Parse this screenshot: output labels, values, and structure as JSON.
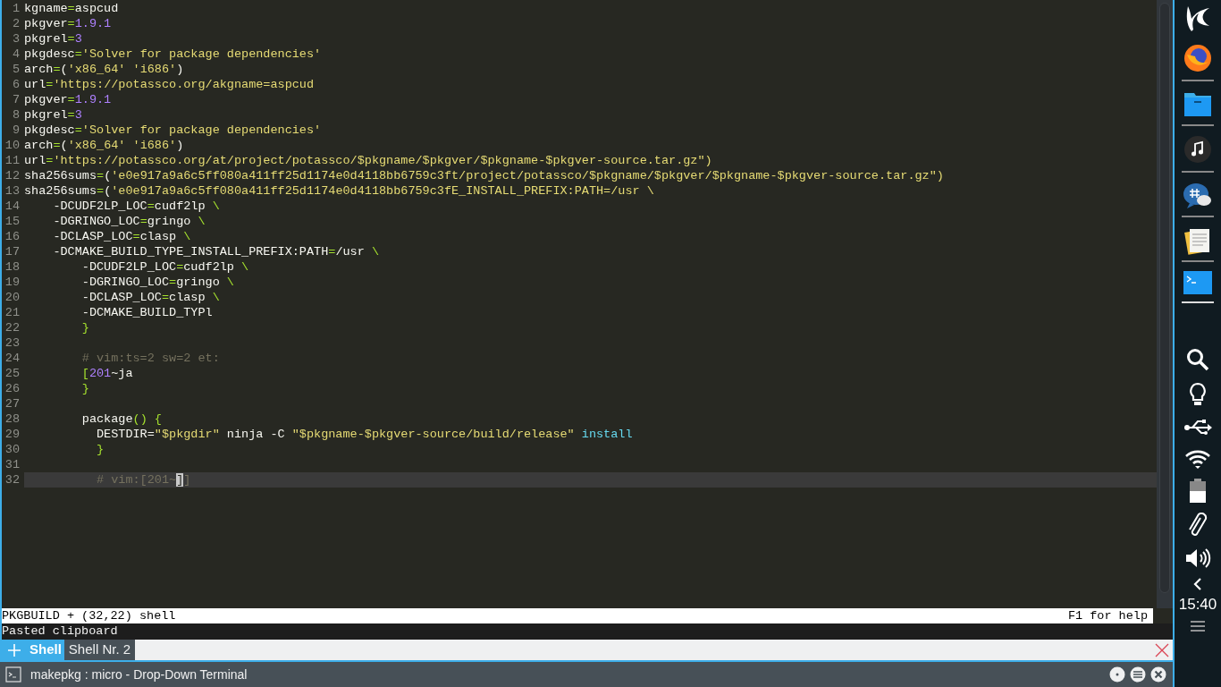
{
  "editor": {
    "lines": [
      {
        "number": "1",
        "current": false,
        "tokens": [
          {
            "kind": "plain",
            "text": "kgname"
          },
          {
            "kind": "op",
            "text": "="
          },
          {
            "kind": "plain",
            "text": "aspcud"
          }
        ]
      },
      {
        "number": "2",
        "current": false,
        "tokens": [
          {
            "kind": "plain",
            "text": "pkgver"
          },
          {
            "kind": "op",
            "text": "="
          },
          {
            "kind": "number",
            "text": "1.9.1"
          }
        ]
      },
      {
        "number": "3",
        "current": false,
        "tokens": [
          {
            "kind": "plain",
            "text": "pkgrel"
          },
          {
            "kind": "op",
            "text": "="
          },
          {
            "kind": "number",
            "text": "3"
          }
        ]
      },
      {
        "number": "4",
        "current": false,
        "tokens": [
          {
            "kind": "plain",
            "text": "pkgdesc"
          },
          {
            "kind": "op",
            "text": "="
          },
          {
            "kind": "string",
            "text": "'Solver for package dependencies'"
          }
        ]
      },
      {
        "number": "5",
        "current": false,
        "tokens": [
          {
            "kind": "plain",
            "text": "arch"
          },
          {
            "kind": "op",
            "text": "="
          },
          {
            "kind": "plain",
            "text": "("
          },
          {
            "kind": "string",
            "text": "'x86_64' 'i686'"
          },
          {
            "kind": "plain",
            "text": ")"
          }
        ]
      },
      {
        "number": "6",
        "current": false,
        "tokens": [
          {
            "kind": "plain",
            "text": "url"
          },
          {
            "kind": "op",
            "text": "="
          },
          {
            "kind": "string",
            "text": "'https://potassco.org/akgname=aspcud"
          }
        ]
      },
      {
        "number": "7",
        "current": false,
        "tokens": [
          {
            "kind": "plain",
            "text": "pkgver"
          },
          {
            "kind": "op",
            "text": "="
          },
          {
            "kind": "number",
            "text": "1.9.1"
          }
        ]
      },
      {
        "number": "8",
        "current": false,
        "tokens": [
          {
            "kind": "plain",
            "text": "pkgrel"
          },
          {
            "kind": "op",
            "text": "="
          },
          {
            "kind": "number",
            "text": "3"
          }
        ]
      },
      {
        "number": "9",
        "current": false,
        "tokens": [
          {
            "kind": "plain",
            "text": "pkgdesc"
          },
          {
            "kind": "op",
            "text": "="
          },
          {
            "kind": "string",
            "text": "'Solver for package dependencies'"
          }
        ]
      },
      {
        "number": "10",
        "current": false,
        "tokens": [
          {
            "kind": "plain",
            "text": "arch"
          },
          {
            "kind": "op",
            "text": "="
          },
          {
            "kind": "plain",
            "text": "("
          },
          {
            "kind": "string",
            "text": "'x86_64' 'i686'"
          },
          {
            "kind": "plain",
            "text": ")"
          }
        ]
      },
      {
        "number": "11",
        "current": false,
        "tokens": [
          {
            "kind": "plain",
            "text": "url"
          },
          {
            "kind": "op",
            "text": "="
          },
          {
            "kind": "string",
            "text": "'https://potassco.org/at/project/potassco/$pkgname/$pkgver/$pkgname-$pkgver-source.tar.gz\")"
          }
        ]
      },
      {
        "number": "12",
        "current": false,
        "tokens": [
          {
            "kind": "plain",
            "text": "sha256sums"
          },
          {
            "kind": "op",
            "text": "="
          },
          {
            "kind": "plain",
            "text": "("
          },
          {
            "kind": "string",
            "text": "'e0e917a9a6c5ff080a411ff25d1174e0d4118bb6759c3ft/project/potassco/$pkgname/$pkgver/$pkgname-$pkgver-source.tar.gz\")"
          }
        ]
      },
      {
        "number": "13",
        "current": false,
        "tokens": [
          {
            "kind": "plain",
            "text": "sha256sums"
          },
          {
            "kind": "op",
            "text": "="
          },
          {
            "kind": "plain",
            "text": "("
          },
          {
            "kind": "string",
            "text": "'e0e917a9a6c5ff080a411ff25d1174e0d4118bb6759c3fE_INSTALL_PREFIX:PATH=/usr \\"
          }
        ]
      },
      {
        "number": "14",
        "current": false,
        "tokens": [
          {
            "kind": "plain",
            "text": "    -DCUDF2LP_LOC"
          },
          {
            "kind": "op",
            "text": "="
          },
          {
            "kind": "plain",
            "text": "cudf2lp "
          },
          {
            "kind": "op",
            "text": "\\"
          }
        ]
      },
      {
        "number": "15",
        "current": false,
        "tokens": [
          {
            "kind": "plain",
            "text": "    -DGRINGO_LOC"
          },
          {
            "kind": "op",
            "text": "="
          },
          {
            "kind": "plain",
            "text": "gringo "
          },
          {
            "kind": "op",
            "text": "\\"
          }
        ]
      },
      {
        "number": "16",
        "current": false,
        "tokens": [
          {
            "kind": "plain",
            "text": "    -DCLASP_LOC"
          },
          {
            "kind": "op",
            "text": "="
          },
          {
            "kind": "plain",
            "text": "clasp "
          },
          {
            "kind": "op",
            "text": "\\"
          }
        ]
      },
      {
        "number": "17",
        "current": false,
        "tokens": [
          {
            "kind": "plain",
            "text": "    -DCMAKE_BUILD_TYPE_INSTALL_PREFIX:PATH"
          },
          {
            "kind": "op",
            "text": "="
          },
          {
            "kind": "plain",
            "text": "/usr "
          },
          {
            "kind": "op",
            "text": "\\"
          }
        ]
      },
      {
        "number": "18",
        "current": false,
        "tokens": [
          {
            "kind": "plain",
            "text": "        -DCUDF2LP_LOC"
          },
          {
            "kind": "op",
            "text": "="
          },
          {
            "kind": "plain",
            "text": "cudf2lp "
          },
          {
            "kind": "op",
            "text": "\\"
          }
        ]
      },
      {
        "number": "19",
        "current": false,
        "tokens": [
          {
            "kind": "plain",
            "text": "        -DGRINGO_LOC"
          },
          {
            "kind": "op",
            "text": "="
          },
          {
            "kind": "plain",
            "text": "gringo "
          },
          {
            "kind": "op",
            "text": "\\"
          }
        ]
      },
      {
        "number": "20",
        "current": false,
        "tokens": [
          {
            "kind": "plain",
            "text": "        -DCLASP_LOC"
          },
          {
            "kind": "op",
            "text": "="
          },
          {
            "kind": "plain",
            "text": "clasp "
          },
          {
            "kind": "op",
            "text": "\\"
          }
        ]
      },
      {
        "number": "21",
        "current": false,
        "tokens": [
          {
            "kind": "plain",
            "text": "        -DCMAKE_BUILD_TYPl"
          }
        ]
      },
      {
        "number": "22",
        "current": false,
        "tokens": [
          {
            "kind": "op",
            "text": "        }"
          }
        ]
      },
      {
        "number": "23",
        "current": false
      },
      {
        "number": "24",
        "current": false,
        "tokens": [
          {
            "kind": "comment",
            "text": "        # vim:ts=2 sw=2 et:"
          }
        ]
      },
      {
        "number": "25",
        "current": false,
        "tokens": [
          {
            "kind": "op",
            "text": "        ["
          },
          {
            "kind": "number",
            "text": "201"
          },
          {
            "kind": "plain",
            "text": "~ja"
          }
        ]
      },
      {
        "number": "26",
        "current": false,
        "tokens": [
          {
            "kind": "op",
            "text": "        }"
          }
        ]
      },
      {
        "number": "27",
        "current": false
      },
      {
        "number": "28",
        "current": false,
        "tokens": [
          {
            "kind": "plain",
            "text": "        package"
          },
          {
            "kind": "op",
            "text": "() {"
          }
        ]
      },
      {
        "number": "29",
        "current": false,
        "tokens": [
          {
            "kind": "plain",
            "text": "          DESTDIR="
          },
          {
            "kind": "string",
            "text": "\"$pkgdir\""
          },
          {
            "kind": "plain",
            "text": " ninja -C "
          },
          {
            "kind": "string",
            "text": "\"$pkgname-$pkgver-source/build/release\""
          },
          {
            "kind": "builtin",
            "text": " install"
          }
        ]
      },
      {
        "number": "30",
        "current": false,
        "tokens": [
          {
            "kind": "op",
            "text": "          }"
          }
        ]
      },
      {
        "number": "31",
        "current": false
      },
      {
        "number": "32",
        "current": true,
        "tokens": [
          {
            "kind": "comment",
            "text": "          # vim:[201~"
          },
          {
            "kind": "cursor",
            "text": "]"
          },
          {
            "kind": "comment",
            "text": "]"
          }
        ]
      }
    ]
  },
  "status_bar": {
    "left": "PKGBUILD + (32,22) shell",
    "right": "F1 for help"
  },
  "message": "Pasted clipboard",
  "tabs": [
    {
      "label": "Shell",
      "selected": true
    },
    {
      "label": "Shell Nr. 2",
      "selected": false
    }
  ],
  "window": {
    "title": "makepkg : micro - Drop-Down Terminal"
  },
  "panel": {
    "clock": "15:40"
  }
}
